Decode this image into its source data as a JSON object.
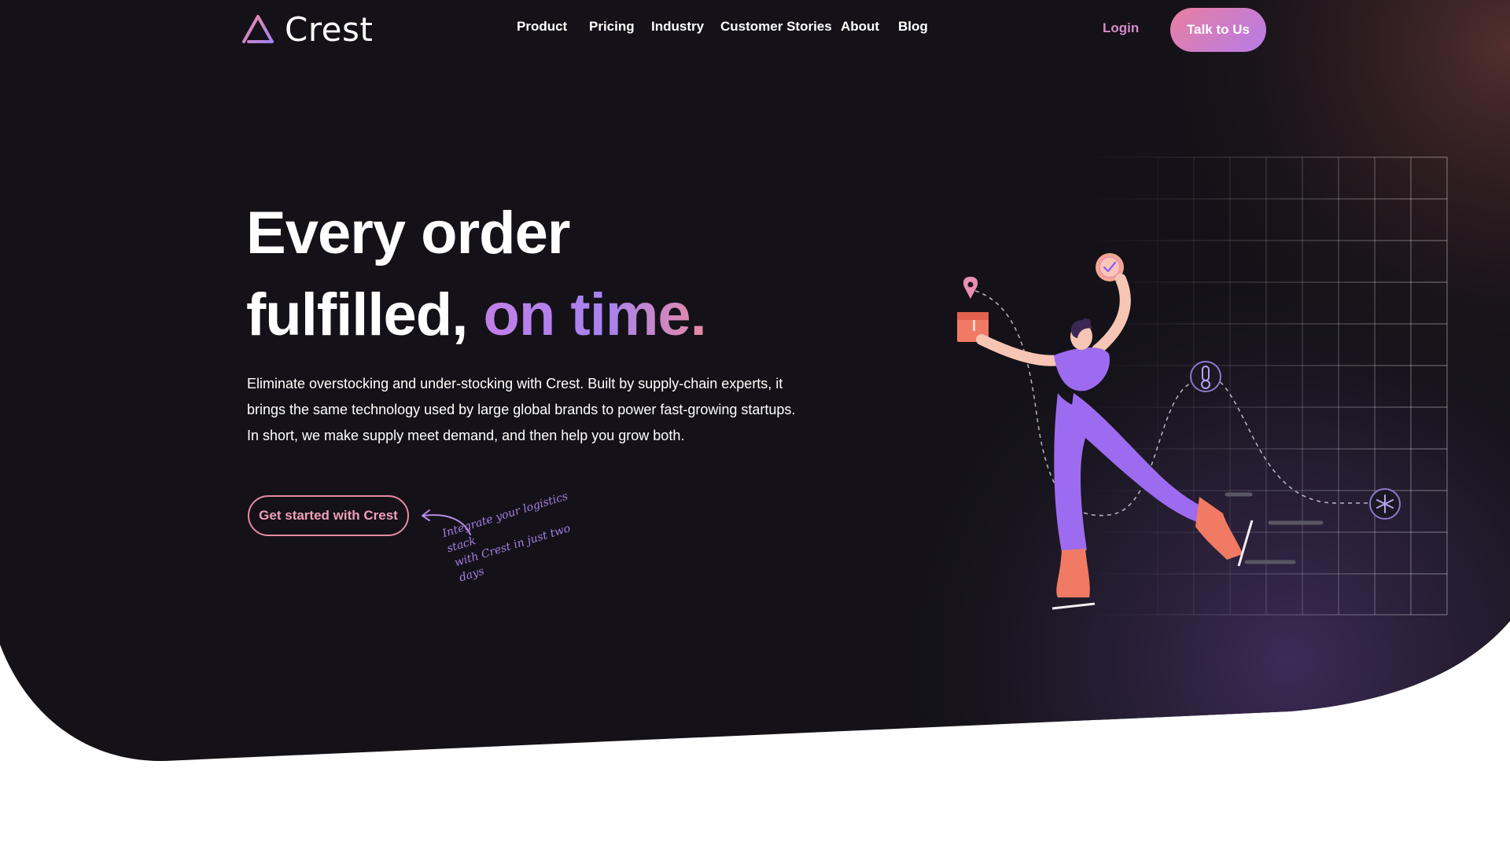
{
  "header": {
    "brand": "Crest",
    "nav": [
      {
        "label": "Product"
      },
      {
        "label": "Pricing"
      },
      {
        "label": "Industry"
      },
      {
        "label": "Customer Stories"
      },
      {
        "label": "About"
      },
      {
        "label": "Blog"
      }
    ],
    "login_label": "Login",
    "cta_label": "Talk to Us"
  },
  "hero": {
    "headline_line1": "Every order",
    "headline_line2": "fulfilled,",
    "headline_accent": "on time.",
    "description": "Eliminate overstocking and under-stocking with Crest. Built by supply-chain experts, it brings the same technology used by large global brands to power fast-growing startups. In short, we make supply meet demand, and then help you grow both.",
    "cta_label": "Get started with Crest",
    "handwritten_note_line1": "Integrate your logistics stack",
    "handwritten_note_line2": "with Crest in just two days"
  },
  "icons": {
    "logo": "triangle-logo-icon",
    "arrow": "curved-arrow-icon",
    "illustration": [
      "location-pin-icon",
      "package-icon",
      "clock-check-icon",
      "temperature-icon",
      "snowflake-icon"
    ]
  },
  "colors": {
    "background": "#141218",
    "accent_pink": "#e98aa3",
    "accent_purple": "#a682f0",
    "login": "#d58bc7"
  }
}
